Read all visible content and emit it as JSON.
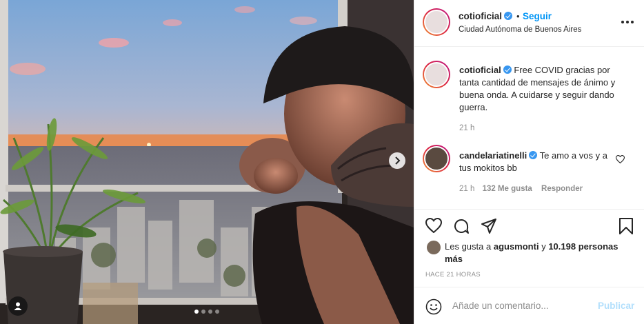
{
  "post": {
    "dots_count": 4,
    "active_dot": 0
  },
  "header": {
    "username": "cotioficial",
    "separator": "•",
    "follow_label": "Seguir",
    "location": "Ciudad Autónoma de Buenos Aires"
  },
  "caption": {
    "username": "cotioficial",
    "text": "Free COVID gracias por tanta cantidad de mensajes de ánimo y buena onda. A cuidarse y seguir dando guerra.",
    "time": "21 h"
  },
  "comment": {
    "username": "candelariatinelli",
    "text": "Te amo a vos y a tus mokitos bb",
    "time": "21 h",
    "likes": "132 Me gusta",
    "reply_label": "Responder"
  },
  "likes": {
    "prefix": "Les gusta a",
    "user": "agusmonti",
    "connector": "y",
    "count": "10.198 personas más"
  },
  "timestamp": "HACE 21 HORAS",
  "add_comment": {
    "placeholder": "Añade un comentario...",
    "publish_label": "Publicar"
  },
  "icons": {
    "next": "chevron-right-icon",
    "tag": "user-tag-icon",
    "more": "more-options-icon",
    "like": "heart-icon",
    "comment": "comment-icon",
    "share": "share-icon",
    "save": "bookmark-icon",
    "emoji": "emoji-icon"
  },
  "colors": {
    "accent": "#0095f6",
    "verified": "#3897f0",
    "publish_disabled": "#b2dffc",
    "muted": "#8e8e8e"
  }
}
